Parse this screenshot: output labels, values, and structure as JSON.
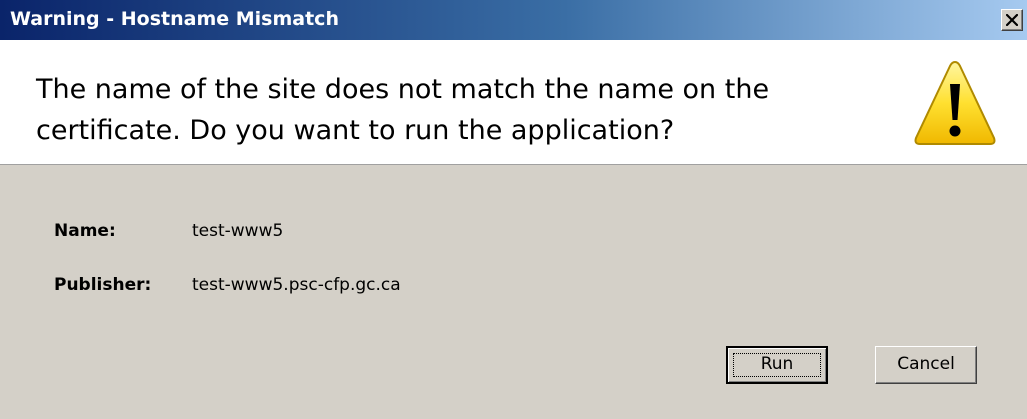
{
  "window": {
    "title": "Warning - Hostname Mismatch"
  },
  "message": {
    "line1": "The name of the site does not match the name on the",
    "line2": "certificate.  Do you want to run the application?"
  },
  "info": {
    "name_label": "Name:",
    "name_value": "test-www5",
    "publisher_label": "Publisher:",
    "publisher_value": "test-www5.psc-cfp.gc.ca"
  },
  "buttons": {
    "run_label": "Run",
    "cancel_label": "Cancel"
  },
  "icons": {
    "warning": "warning-triangle-icon",
    "close": "close-icon"
  },
  "colors": {
    "titlebar_start": "#0a246a",
    "titlebar_end": "#a6caf0",
    "dialog_bg": "#d4d0c8",
    "warning_yellow": "#ffd700"
  }
}
